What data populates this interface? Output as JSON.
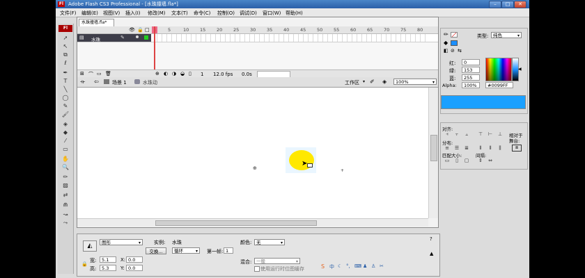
{
  "window": {
    "app_logo": "Fl",
    "title": "Adobe Flash CS3 Professional - [水珠撞墙.fla*]",
    "minimize": "–",
    "maximize": "□",
    "close": "✕"
  },
  "menus": [
    "文件(F)",
    "编辑(E)",
    "视图(V)",
    "插入(I)",
    "修改(M)",
    "文本(T)",
    "命令(C)",
    "控制(O)",
    "调试(D)",
    "窗口(W)",
    "帮助(H)"
  ],
  "tools_badge": "Fl",
  "document": {
    "tab": "水珠撞墙.fla*",
    "ruler": [
      "1",
      "5",
      "10",
      "15",
      "20",
      "25",
      "30",
      "35",
      "40",
      "45",
      "50",
      "55",
      "60",
      "65",
      "70",
      "75",
      "80"
    ],
    "layer_name": "水珠",
    "status": {
      "frame": "1",
      "fps": "12.0 fps",
      "time": "0.0s"
    },
    "breadcrumb_scene": "场景 1",
    "breadcrumb_symbol": "水珠动",
    "workspace": "工作区",
    "zoom": "100%",
    "ball_color": "#ffe800"
  },
  "properties": {
    "type_value": "图形",
    "instance_label": "实例:",
    "instance_name": "水珠",
    "swap_button": "交换...",
    "loop_value": "循环",
    "first_frame_label": "第一帧:",
    "first_frame_value": "1",
    "color_label": "颜色:",
    "color_value": "无",
    "blend_label": "混合:",
    "blend_value": "一般",
    "cache_label": "使用运行时位图缓存",
    "w_label": "宽:",
    "w_value": "5.1",
    "h_label": "高:",
    "h_value": "5.3",
    "x_label": "X:",
    "x_value": "0.0",
    "y_label": "Y:",
    "y_value": "0.0"
  },
  "color_panel": {
    "type_label": "类型:",
    "type_value": "纯色",
    "r_label": "红:",
    "r_value": "0",
    "g_label": "绿:",
    "g_value": "153",
    "b_label": "蓝:",
    "b_value": "255",
    "alpha_label": "Alpha:",
    "alpha_value": "100%",
    "hex_value": "#0099FF",
    "swatch_color": "#1aa0ff"
  },
  "align_panel": {
    "align_label": "对齐:",
    "distribute_label": "分布:",
    "match_size_label": "匹配大小:",
    "spacing_label": "间隔:",
    "to_stage_label": "相对于舞台:"
  }
}
